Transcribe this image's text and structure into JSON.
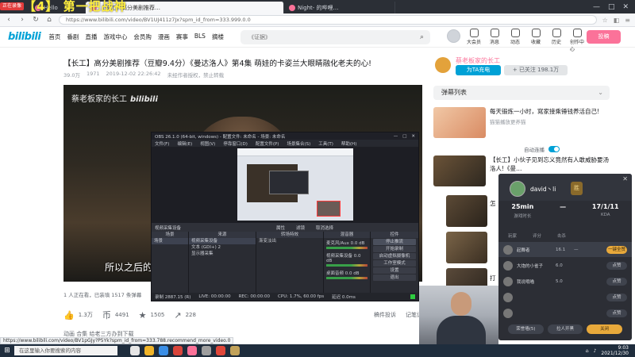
{
  "browser": {
    "record_badge": "正在录像",
    "overlay_title": "【4】 第一把战神",
    "tabs": [
      {
        "label": "Hello",
        "active": false
      },
      {
        "label": "【长工】高分美剧推荐…",
        "active": true
      },
      {
        "label": "Night- 的哔哩…",
        "active": false
      }
    ],
    "url": "https://www.bilibili.com/video/BV1UJ411z7Jx?spm_id_from=333.999.0.0",
    "window_controls": [
      "—",
      "□",
      "✕"
    ]
  },
  "site": {
    "logo": "bilibili",
    "nav": [
      "首页",
      "番剧",
      "直播",
      "游戏中心",
      "会员购",
      "漫画",
      "赛事",
      "BLS",
      "摘楼"
    ],
    "search_placeholder": "《证据》",
    "header_icons": [
      "大会员",
      "消息",
      "动态",
      "收藏",
      "历史",
      "创作中心"
    ],
    "upload_label": "投稿"
  },
  "video": {
    "title": "【长工】高分美剧推荐（豆瓣9.4分）《曼达洛人》第4集 萌娃的卡姿兰大眼睛融化老夫的心!",
    "meta": [
      "39.0万",
      "1971",
      "2019-12-02 22:26:42",
      "未经作者授权，禁止转载"
    ],
    "watermark_text": "蔡老板家的长工",
    "watermark_logo": "bilibili",
    "subtitle": "所以之后的",
    "viewer_line": "1 人正在看，已装填 1517 条弹幕",
    "actions": [
      {
        "icon": "like-icon",
        "glyph": "👍",
        "value": "1.3万"
      },
      {
        "icon": "coin-icon",
        "glyph": "币",
        "value": "4491"
      },
      {
        "icon": "favorite-icon",
        "glyph": "★",
        "value": "1505"
      },
      {
        "icon": "share-icon",
        "glyph": "↗",
        "value": "228"
      }
    ],
    "extra_actions": [
      "稿件投诉",
      "记笔记"
    ],
    "tags": "动画  合集  给老三方办到下载"
  },
  "uploader": {
    "name": "蔡老板家的长工",
    "charge_label": "为TA充电",
    "follow_label": "+ 已关注 198.1万"
  },
  "sidebar": {
    "danmu_list_label": "弹幕列表",
    "autoplay_label": "自动连播",
    "rec1_title": "每天锻炼一小时，寫家接乘锤钱养活自己!",
    "rec1_author": "猫猫播放更养猫",
    "rec2_title": "【长工】小伙子见到忘义竟然有人敢威胁要汤洛人!《曼…",
    "side_labels": [
      "怎",
      "打"
    ]
  },
  "obs": {
    "title": "OBS 26.1.0 (64-bit, windows) - 配置文件: 未命名 - 场景: 未命名",
    "menu": [
      "文件(F)",
      "编辑(E)",
      "视图(V)",
      "停靠窗口(D)",
      "配置文件(P)",
      "场景集合(S)",
      "工具(T)",
      "帮助(H)"
    ],
    "source_bar_left": "视频采集设备",
    "source_bar_items": [
      "属性",
      "滤镜",
      "取消选择"
    ],
    "docks": [
      "场景",
      "来源",
      "转场特效",
      "混音器",
      "控件"
    ],
    "scenes": [
      "场景"
    ],
    "sources": [
      "视频采集设备",
      "文本 (GDI+) 2",
      "显示器采集"
    ],
    "transition": "渐变淡出",
    "mixer": [
      {
        "name": "麦克风/Aux",
        "value": "0.0 dB"
      },
      {
        "name": "视频采集设备",
        "value": "0.0 dB"
      },
      {
        "name": "桌面音频",
        "value": "0.0 dB"
      }
    ],
    "controls": [
      "停止推流",
      "开始录制",
      "启动虚拟摄像机",
      "工作室模式",
      "设置",
      "退出"
    ],
    "status": [
      "录制 2887.15 (R)",
      "LIVE: 00:00:00",
      "REC: 00:00:00",
      "CPU: 1.7%, 60.00 fps",
      "延迟 0.0ms"
    ]
  },
  "game_panel": {
    "close": "✕",
    "player_name": "david丶li",
    "badge": "胜",
    "stats": [
      {
        "value": "25min",
        "label": "游戏时长"
      },
      {
        "value": "—",
        "label": ""
      },
      {
        "value": "17/1/11",
        "label": "KDA"
      }
    ],
    "columns": [
      "玩家",
      "评分",
      "击杀"
    ],
    "rows": [
      {
        "name": "起舞者",
        "score": "16.1",
        "rank": "—",
        "button": "一键全赞",
        "me": true
      },
      {
        "name": "大炮的小雀子",
        "score": "6.0",
        "rank": "",
        "button": "点赞",
        "me": false
      },
      {
        "name": "我说哦喵",
        "score": "5.0",
        "rank": "",
        "button": "点赞",
        "me": false
      },
      {
        "name": "",
        "score": "",
        "rank": "",
        "button": "点赞",
        "me": false
      },
      {
        "name": "",
        "score": "",
        "rank": "",
        "button": "点赞",
        "me": false
      }
    ],
    "footer_buttons": [
      "荣誉墙(5)",
      "拉人开黑",
      "关闭"
    ]
  },
  "statusbar_url": "https://www.bilibili.com/video/BV1pGJy?P5Yk?spm_id_from=333.788.recommend_more_video.0",
  "taskbar": {
    "search_placeholder": "在这里输入你要搜索的内容",
    "time": "9:03",
    "date": "2021/12/30"
  }
}
